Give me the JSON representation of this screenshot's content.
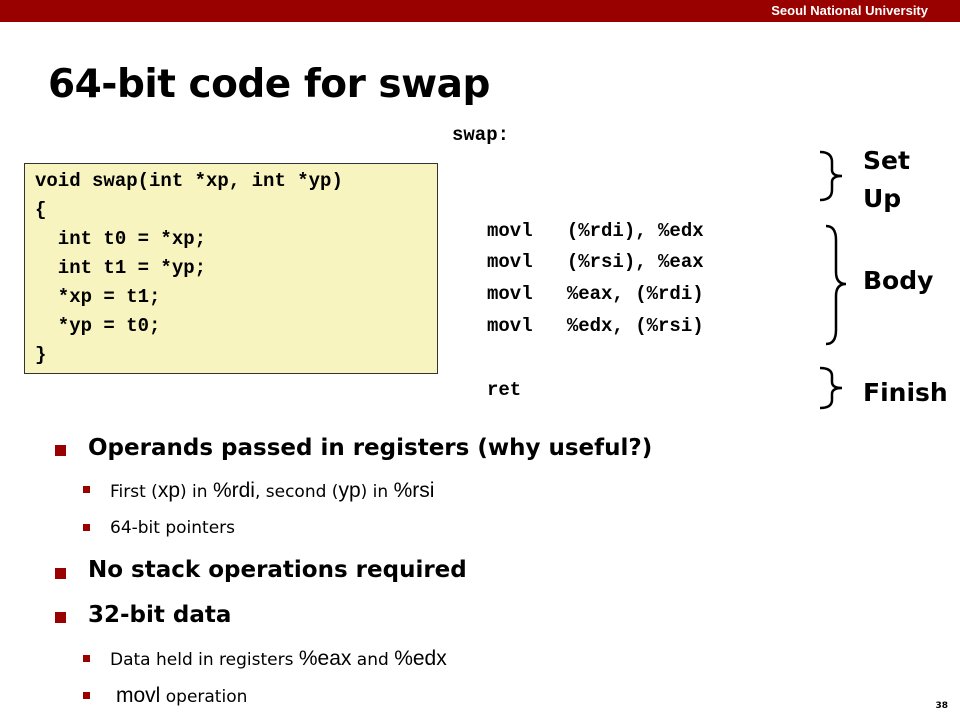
{
  "header": {
    "institution": "Seoul National University"
  },
  "title": "64-bit code for swap",
  "c_code": [
    "void swap(int *xp, int *yp)",
    "{",
    "  int t0 = *xp;",
    "  int t1 = *yp;",
    "  *xp = t1;",
    "  *yp = t0;",
    "}"
  ],
  "assembly": {
    "label": "swap:",
    "body": [
      "movl   (%rdi), %edx",
      "movl   (%rsi), %eax",
      "movl   %eax, (%rdi)",
      "movl   %edx, (%rsi)"
    ],
    "ret": "ret"
  },
  "annotations": {
    "setup_1": "Set",
    "setup_2": "Up",
    "body": "Body",
    "finish": "Finish"
  },
  "bullets": {
    "b1": "Operands passed in registers (why useful?)",
    "b1_s1": {
      "t1": "First (",
      "t2": "xp",
      "t3": ") in ",
      "t4": "%rdi",
      "t5": ", second (",
      "t6": "yp",
      "t7": ") in ",
      "t8": "%rsi"
    },
    "b1_s2": "64-bit pointers",
    "b2": "No stack operations required",
    "b3": "32-bit data",
    "b3_s1": {
      "t1": "Data held in registers ",
      "t2": "%eax",
      "t3": " and ",
      "t4": "%edx"
    },
    "b3_s2": {
      "t1": "movl",
      "t2": " operation"
    }
  },
  "page_number": "38",
  "colors": {
    "accent": "#990000",
    "code_bg": "#f7f4c0"
  }
}
